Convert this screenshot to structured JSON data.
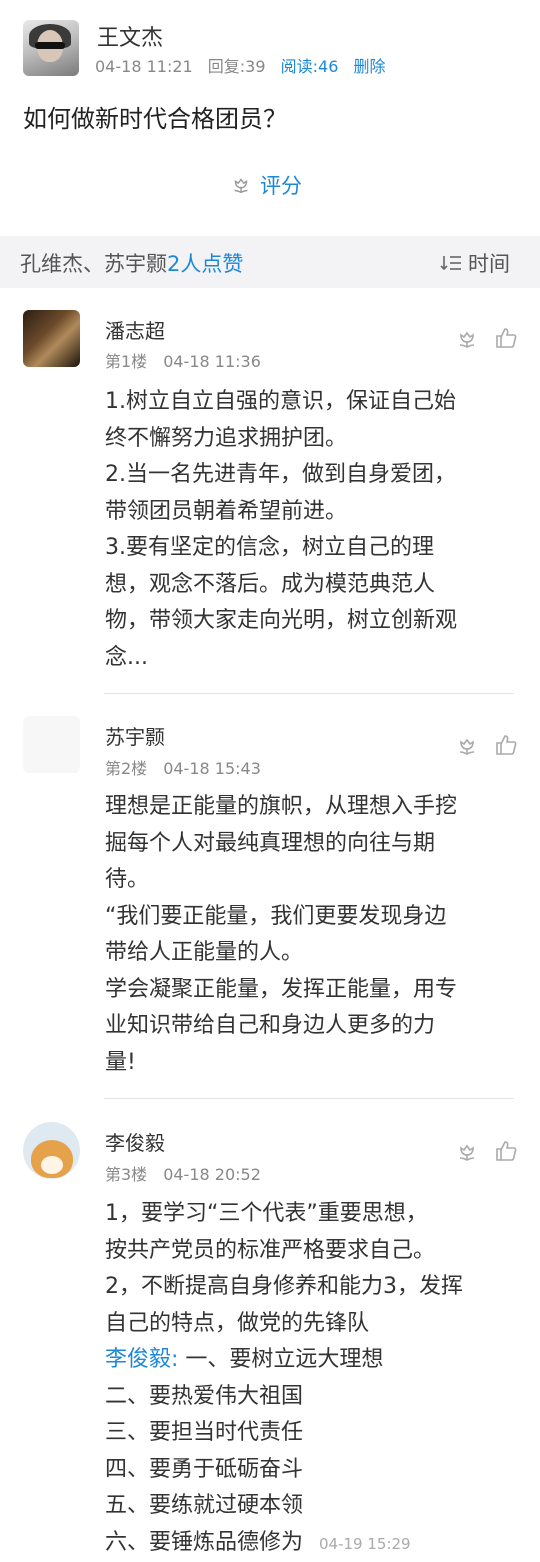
{
  "post": {
    "author": "王文杰",
    "date": "04-18 11:21",
    "replies_label": "回复:39",
    "reads_label": "阅读:46",
    "delete_label": "删除",
    "title": "如何做新时代合格团员？",
    "rate_label": "评分"
  },
  "likes": {
    "names": "孔维杰、苏宇颢",
    "count_label": "2人点赞",
    "sort_label": "时间"
  },
  "comments": [
    {
      "name": "潘志超",
      "floor": "第1楼",
      "time": "04-18 11:36",
      "lines": [
        "1.树立自立自强的意识，保证自己始",
        "终不懈努力追求拥护团。",
        "2.当一名先进青年，做到自身爱团，",
        "带领团员朝着希望前进。",
        "3.要有坚定的信念，树立自己的理",
        "想，观念不落后。成为模范典范人",
        "物，带领大家走向光明，树立创新观",
        "念..."
      ]
    },
    {
      "name": "苏宇颢",
      "floor": "第2楼",
      "time": "04-18 15:43",
      "lines": [
        "理想是正能量的旗帜，从理想入手挖",
        "掘每个人对最纯真理想的向往与期",
        "待。",
        "“我们要正能量，我们更要发现身边",
        "带给人正能量的人。",
        "学会凝聚正能量，发挥正能量，用专",
        "业知识带给自己和身边人更多的力",
        "量!"
      ]
    },
    {
      "name": "李俊毅",
      "floor": "第3楼",
      "time": "04-18 20:52",
      "lines": [
        "1，要学习“三个代表”重要思想，",
        "按共产党员的标准严格要求自己。",
        "2，不断提高自身修养和能力3，发挥",
        "自己的特点，做党的先锋队"
      ],
      "reply": {
        "author": "李俊毅:",
        "first": " 一、要树立远大理想",
        "lines": [
          "二、要热爱伟大祖国",
          "三、要担当时代责任",
          "四、要勇于砥砺奋斗",
          "五、要练就过硬本领"
        ],
        "last": "六、要锤炼品德修为",
        "time": "04-19 15:29"
      }
    }
  ],
  "icons": {
    "rate": "flower-icon",
    "flower": "flower-icon",
    "thumb": "thumbs-up-icon",
    "sort": "sort-icon"
  },
  "colors": {
    "accent": "#1e88d8",
    "likes_bg": "#f3f3f5"
  }
}
